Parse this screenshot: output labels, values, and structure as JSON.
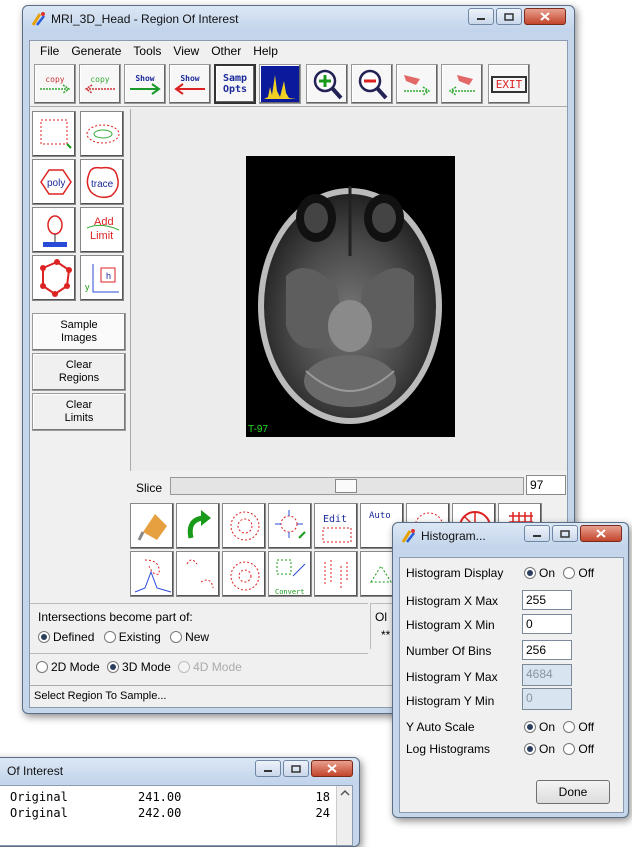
{
  "main_window": {
    "title": "MRI_3D_Head - Region Of Interest",
    "menu": [
      "File",
      "Generate",
      "Tools",
      "View",
      "Other",
      "Help"
    ],
    "toolbar": {
      "copy_right": "copy",
      "copy_left": "copy",
      "show_right": "Show",
      "show_left": "Show",
      "samp_opts_1": "Samp",
      "samp_opts_2": "Opts",
      "exit": "EXIT"
    },
    "tools": {
      "poly": "poly",
      "trace": "trace",
      "add_limit_1": "Add",
      "add_limit_2": "Limit",
      "h_label": "h",
      "y_label": "y"
    },
    "side_buttons": [
      {
        "line1": "Sample",
        "line2": "Images"
      },
      {
        "line1": "Clear",
        "line2": "Regions"
      },
      {
        "line1": "Clear",
        "line2": "Limits"
      }
    ],
    "image_label": "T-97",
    "slice": {
      "label": "Slice",
      "value": "97",
      "position": 0.5
    },
    "bottom_tools": {
      "edit": "Edit",
      "auto": "Auto",
      "convert": "Convert"
    },
    "intersections": {
      "label": "Intersections become part of:",
      "options": [
        "Defined",
        "Existing",
        "New"
      ],
      "selected": "Defined"
    },
    "obscured_label": "Ol",
    "obscured_text": "**",
    "modes": {
      "options": [
        "2D Mode",
        "3D Mode",
        "4D Mode"
      ],
      "selected": "3D Mode",
      "disabled": "4D Mode"
    },
    "status": "Select Region To Sample..."
  },
  "histogram_window": {
    "title": "Histogram...",
    "display": {
      "label": "Histogram Display",
      "on": "On",
      "off": "Off",
      "selected": "On"
    },
    "x_max": {
      "label": "Histogram X Max",
      "value": "255"
    },
    "x_min": {
      "label": "Histogram X Min",
      "value": "0"
    },
    "bins": {
      "label": "Number Of Bins",
      "value": "256"
    },
    "y_max": {
      "label": "Histogram Y Max",
      "value": "4684"
    },
    "y_min": {
      "label": "Histogram Y Min",
      "value": "0"
    },
    "y_auto": {
      "label": "Y Auto Scale",
      "on": "On",
      "off": "Off",
      "selected": "On"
    },
    "log": {
      "label": "Log Histograms",
      "on": "On",
      "off": "Off",
      "selected": "On"
    },
    "done": "Done"
  },
  "background_window": {
    "title": "Of Interest",
    "rows": [
      {
        "name": "Original",
        "value": "241.00",
        "count": "18"
      },
      {
        "name": "Original",
        "value": "242.00",
        "count": "24"
      }
    ]
  },
  "colors": {
    "title_bg": "#c6d6ea",
    "close_red": "#c2452c",
    "image_bg": "#000000",
    "label_green": "#22dd22"
  }
}
